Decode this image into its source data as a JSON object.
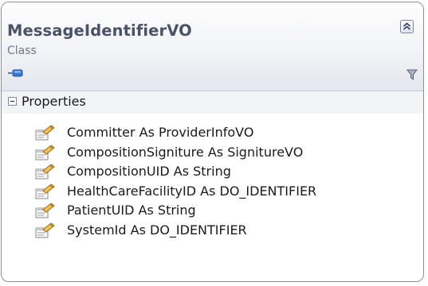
{
  "class_shape": {
    "name": "MessageIdentifierVO",
    "stereotype": "Class",
    "collapse_icon": "double-chevron-up-icon",
    "shortcut_icon": "shortcut-arrow-icon",
    "filter_icon": "funnel-filter-icon"
  },
  "compartment": {
    "toggle_icon": "collapse-minus-icon",
    "title": "Properties",
    "member_icon": "property-icon",
    "members": [
      "Committer As ProviderInfoVO",
      "CompositionSigniture As SignitureVO",
      "CompositionUID As String",
      "HealthCareFacilityID As DO_IDENTIFIER",
      "PatientUID As String",
      "SystemId As DO_IDENTIFIER"
    ]
  },
  "colors": {
    "border": "#8e8e8e",
    "title": "#4a5268",
    "header_gradient_top": "#fdfdfd",
    "header_gradient_bottom": "#e4e7ee"
  }
}
